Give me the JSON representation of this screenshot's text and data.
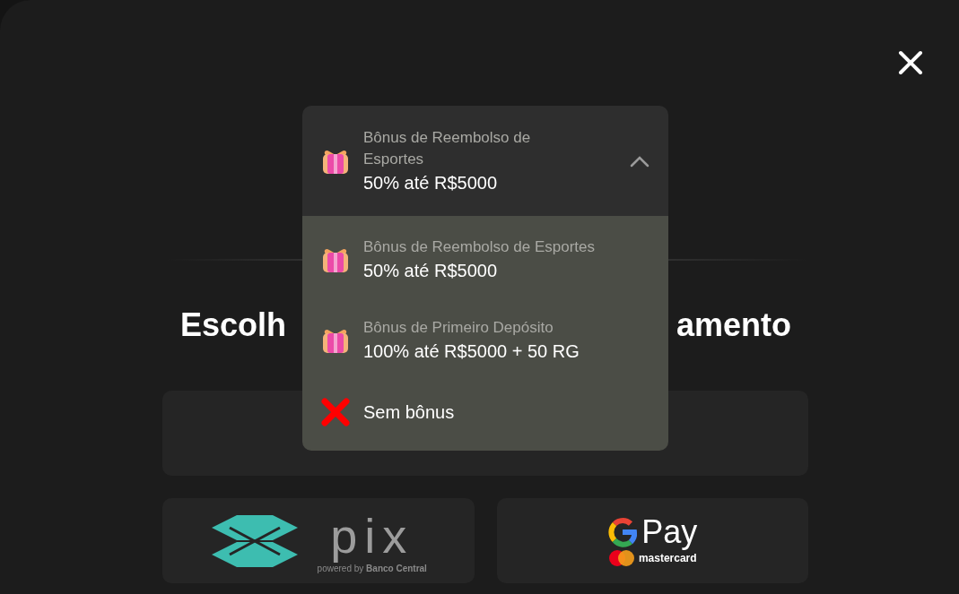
{
  "heading": {
    "left": "Escolh",
    "right": "amento"
  },
  "bonus_select": {
    "expanded": true,
    "current": {
      "title": "Bônus de Reembolso de Esportes",
      "detail": "50% até R$5000"
    },
    "options": [
      {
        "kind": "gift",
        "title": "Bônus de Reembolso de Esportes",
        "detail": "50% até R$5000"
      },
      {
        "kind": "gift",
        "title": "Bônus de Primeiro Depósito",
        "detail": "100% até R$5000 + 50 RG"
      },
      {
        "kind": "none",
        "detail": "Sem bônus"
      }
    ]
  },
  "payment_methods": [
    {
      "kind": "pix",
      "wordmark": "pix",
      "caption_start": "powered by",
      "caption_end": "Banco Central"
    },
    {
      "kind": "gpay",
      "wordmark": "Pay",
      "caption": "mastercard"
    }
  ]
}
